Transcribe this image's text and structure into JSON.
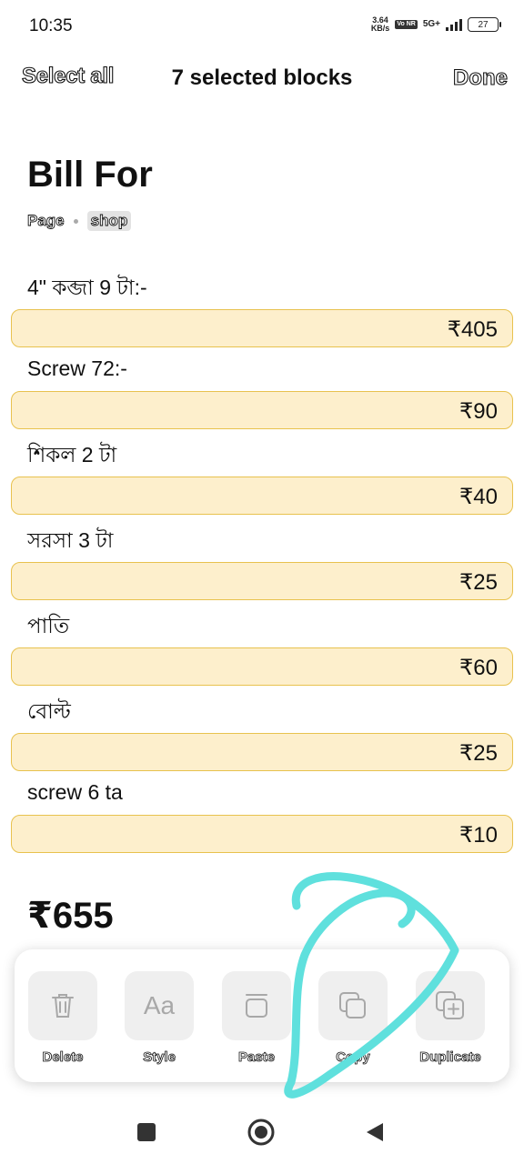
{
  "status_bar": {
    "time": "10:35",
    "speed_value": "3.64",
    "speed_unit": "KB/s",
    "volte": "Vo NR",
    "network": "5G+",
    "battery": "27"
  },
  "toolbar": {
    "select_all": "Select all",
    "title": "7 selected blocks",
    "done": "Done"
  },
  "page": {
    "title": "Bill For",
    "type": "Page",
    "tag": "shop"
  },
  "items": [
    {
      "label": "4\" কব্জা 9 টা:-",
      "price": "₹405"
    },
    {
      "label": "Screw 72:-",
      "price": "₹90"
    },
    {
      "label": "শিকল 2 টা",
      "price": "₹40"
    },
    {
      "label": "সরসা 3 টা",
      "price": "₹25"
    },
    {
      "label": "পাতি",
      "price": "₹60"
    },
    {
      "label": "বোল্ট",
      "price": "₹25"
    },
    {
      "label": "screw 6 ta",
      "price": "₹10"
    }
  ],
  "total": "₹655",
  "actions": [
    {
      "label": "Delete",
      "icon": "trash-icon"
    },
    {
      "label": "Style",
      "icon": "text-style-icon",
      "glyph": "Aa"
    },
    {
      "label": "Paste",
      "icon": "paste-icon"
    },
    {
      "label": "Copy",
      "icon": "copy-icon"
    },
    {
      "label": "Duplicate",
      "icon": "duplicate-icon"
    }
  ],
  "colors": {
    "price_fill": "#fdefcc",
    "price_border": "#e8c24e",
    "scribble": "#5fe0dd"
  }
}
